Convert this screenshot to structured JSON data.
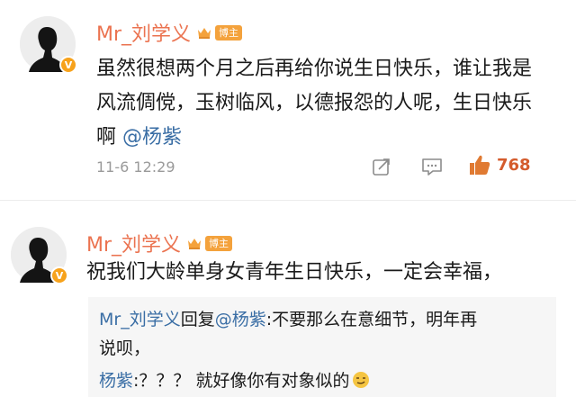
{
  "comments": [
    {
      "username": "Mr_刘学义",
      "badge": "博主",
      "verified": "V",
      "text": "虽然很想两个月之后再给你说生日快乐，谁让我是风流倜傥，玉树临风，以德报怨的人呢，",
      "text_line3": "生日快乐啊",
      "mention": "@杨紫",
      "timestamp": "11-6 12:29",
      "likes": "768"
    },
    {
      "username": "Mr_刘学义",
      "badge": "博主",
      "verified": "V",
      "text": "祝我们大龄单身女青年生日快乐，一定会幸福，",
      "replies": [
        {
          "author": "Mr_刘学义",
          "verb": "回复",
          "target": "@杨紫",
          "content": ":不要那么在意细节，明年再",
          "content_cont": "说呗，"
        },
        {
          "author": "杨紫",
          "content": ":？？？ 就好像你有对象似的"
        }
      ]
    }
  ],
  "colors": {
    "username": "#eb7350",
    "mention": "#3a6ea5",
    "like": "#d45b2c",
    "badge": "#f4a23c",
    "verified": "#f7a21b"
  },
  "icons": {
    "crown": "crown-icon",
    "share": "share-icon",
    "comment": "comment-icon",
    "like": "thumbs-up-icon",
    "emoji": "smirk-emoji-icon"
  }
}
